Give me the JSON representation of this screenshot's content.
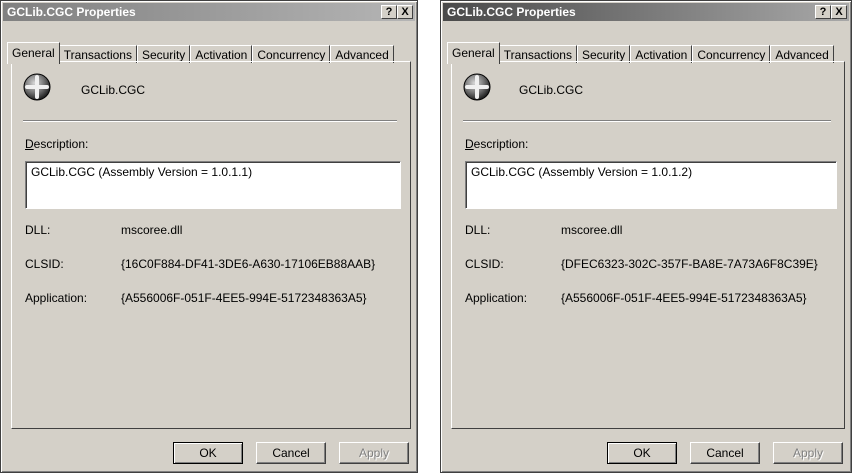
{
  "dialogs": [
    {
      "title": "GCLib.CGC Properties",
      "title_buttons": {
        "help": "?",
        "close": "X"
      },
      "tabs": [
        "General",
        "Transactions",
        "Security",
        "Activation",
        "Concurrency",
        "Advanced"
      ],
      "active_tab": "General",
      "icon": "component-globe-icon",
      "component_name": "GCLib.CGC",
      "description_label_accesskey": "D",
      "description_label_rest": "escription:",
      "description_value": "GCLib.CGC (Assembly Version = 1.0.1.1)",
      "fields": [
        {
          "label": "DLL:",
          "value": "mscoree.dll"
        },
        {
          "label": "CLSID:",
          "value": "{16C0F884-DF41-3DE6-A630-17106EB88AAB}"
        },
        {
          "label": "Application:",
          "value": "{A556006F-051F-4EE5-994E-5172348363A5}"
        }
      ],
      "buttons": {
        "ok": "OK",
        "cancel": "Cancel",
        "apply": "Apply"
      }
    },
    {
      "title": "GCLib.CGC Properties",
      "title_buttons": {
        "help": "?",
        "close": "X"
      },
      "tabs": [
        "General",
        "Transactions",
        "Security",
        "Activation",
        "Concurrency",
        "Advanced"
      ],
      "active_tab": "General",
      "icon": "component-globe-icon",
      "component_name": "GCLib.CGC",
      "description_label_accesskey": "D",
      "description_label_rest": "escription:",
      "description_value": "GCLib.CGC (Assembly Version = 1.0.1.2)",
      "fields": [
        {
          "label": "DLL:",
          "value": "mscoree.dll"
        },
        {
          "label": "CLSID:",
          "value": "{DFEC6323-302C-357F-BA8E-7A73A6F8C39E}"
        },
        {
          "label": "Application:",
          "value": "{A556006F-051F-4EE5-994E-5172348363A5}"
        }
      ],
      "buttons": {
        "ok": "OK",
        "cancel": "Cancel",
        "apply": "Apply"
      }
    }
  ],
  "colors": {
    "dialog_face": "#d4d0c8",
    "titlebar_inactive": "#808080",
    "disabled_text": "#808080"
  }
}
